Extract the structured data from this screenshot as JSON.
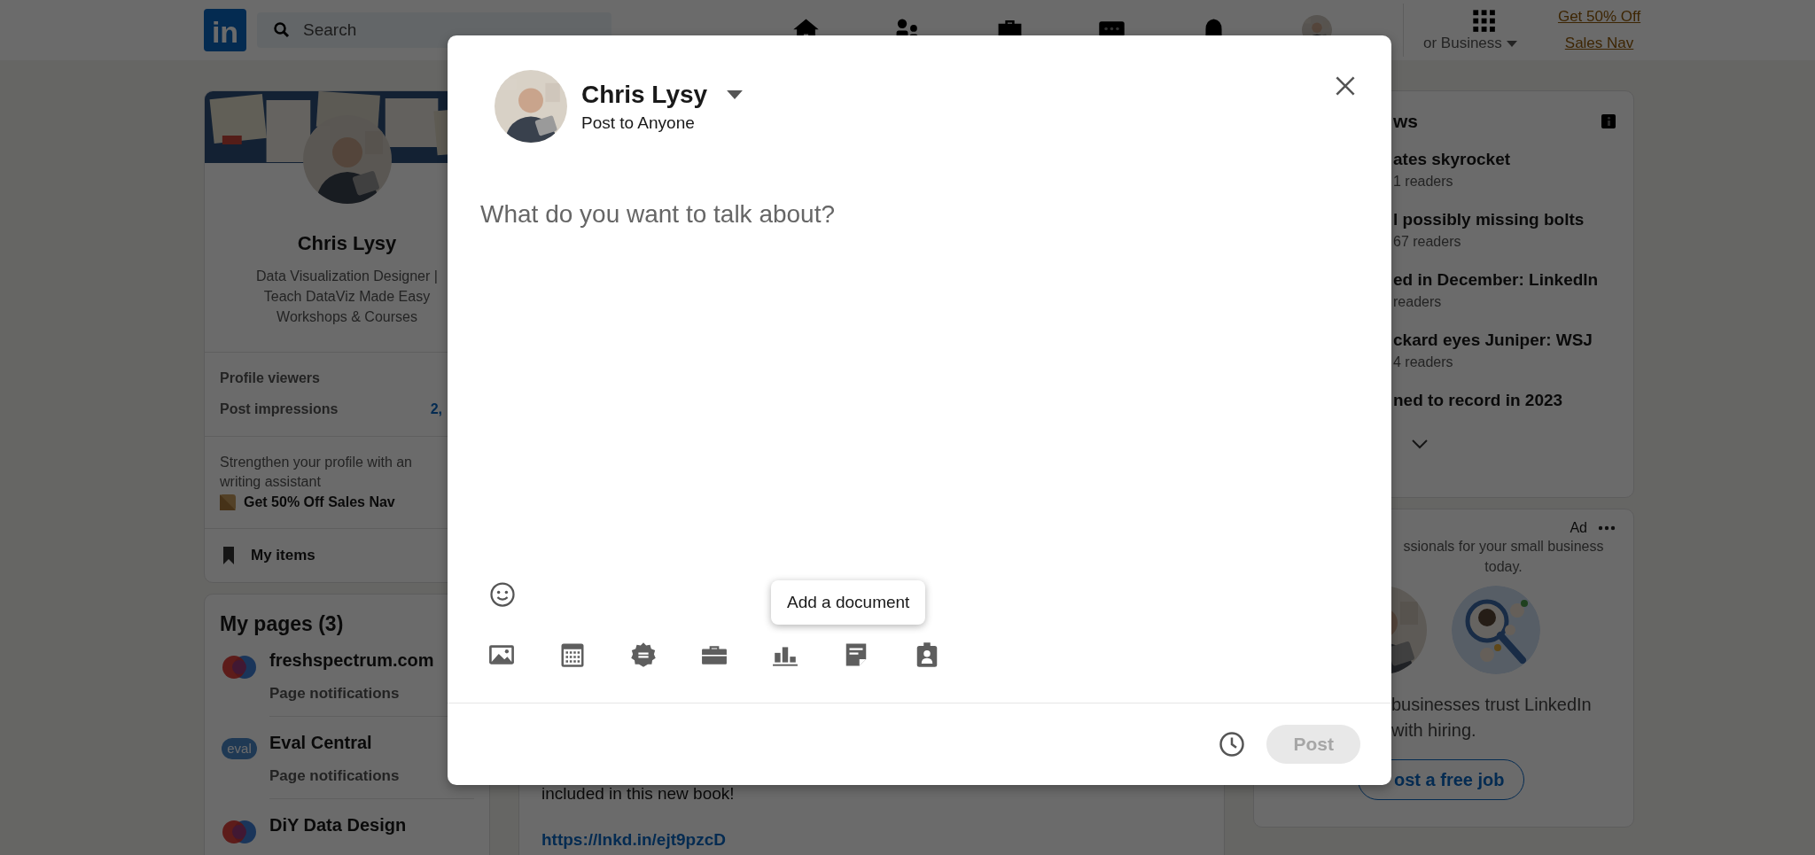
{
  "nav": {
    "logo": "in",
    "search_placeholder": "Search",
    "business_menu": "or Business",
    "premium_link": "Get 50% Off Sales Nav"
  },
  "profile": {
    "name": "Chris Lysy",
    "headline": "Data Visualization Designer |\nTeach DataViz Made Easy\nWorkshops & Courses",
    "stats": [
      {
        "label": "Profile viewers"
      },
      {
        "label": "Post impressions",
        "value": "2,"
      }
    ],
    "promo_text": "Strengthen your profile with an\nwriting assistant",
    "promo_link": "Get 50% Off Sales Nav",
    "saved": "My items"
  },
  "pages": {
    "title": "My pages (3)",
    "items": [
      {
        "kind": "circles",
        "name": "freshspectrum.com",
        "subtitle": "Page notifications"
      },
      {
        "kind": "bubble",
        "logo_text": "eval",
        "name": "Eval Central",
        "subtitle": "Page notifications"
      },
      {
        "kind": "circles",
        "name": "DiY Data Design"
      }
    ]
  },
  "feed": {
    "text": "included in this new book!",
    "link": "https://lnkd.in/ejt9pzcD"
  },
  "news": {
    "title": "ws",
    "items": [
      {
        "title": "ates skyrocket",
        "readers": "1 readers"
      },
      {
        "title": "l possibly missing bolts",
        "readers": "67 readers"
      },
      {
        "title": "ed in December: LinkedIn",
        "readers": "readers"
      },
      {
        "title": "ckard eyes Juniper: WSJ",
        "readers": "4 readers"
      },
      {
        "title": "ned to record in 2023"
      }
    ]
  },
  "ad": {
    "label": "Ad",
    "text": "ssionals for your small business\ntoday.",
    "pitch": "businesses trust LinkedIn\nwith hiring.",
    "button": "ost a free job"
  },
  "composer": {
    "author": "Chris Lysy",
    "audience": "Post to Anyone",
    "placeholder": "What do you want to talk about?",
    "tooltip": "Add a document",
    "post_button": {
      "label": "Post",
      "disabled": true
    }
  }
}
